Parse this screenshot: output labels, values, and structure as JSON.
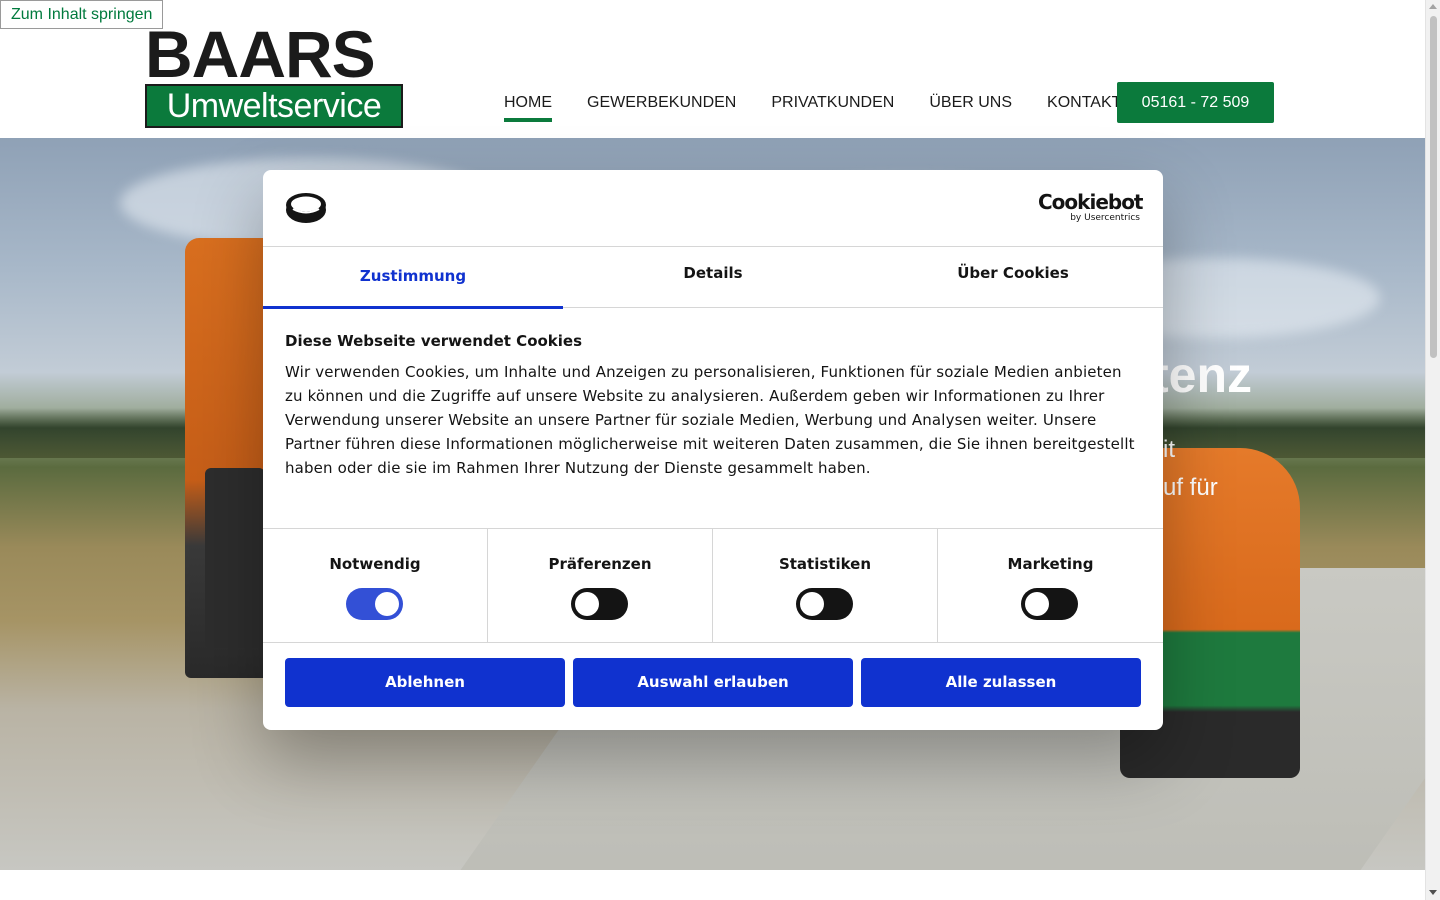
{
  "skip_link": "Zum Inhalt springen",
  "logo": {
    "line1": "BAARS",
    "line2": "Umweltservice"
  },
  "nav": {
    "items": [
      {
        "label": "HOME",
        "active": true
      },
      {
        "label": "GEWERBEKUNDEN",
        "active": false
      },
      {
        "label": "PRIVATKUNDEN",
        "active": false
      },
      {
        "label": "ÜBER UNS",
        "active": false
      },
      {
        "label": "KONTAKT",
        "active": false
      }
    ],
    "phone": "05161 - 72 509"
  },
  "hero": {
    "heading_fragment": "tenz",
    "text_fragment_1": "it",
    "text_fragment_2": "uf für"
  },
  "cookie_dialog": {
    "brand_name": "Cookiebot",
    "brand_sub": "by Usercentrics",
    "tabs": [
      {
        "label": "Zustimmung",
        "active": true
      },
      {
        "label": "Details",
        "active": false
      },
      {
        "label": "Über Cookies",
        "active": false
      }
    ],
    "title": "Diese Webseite verwendet Cookies",
    "text": "Wir verwenden Cookies, um Inhalte und Anzeigen zu personalisieren, Funktionen für soziale Medien anbieten zu können und die Zugriffe auf unsere Website zu analysieren. Außerdem geben wir Informationen zu Ihrer Verwendung unserer Website an unsere Partner für soziale Medien, Werbung und Analysen weiter. Unsere Partner führen diese Informationen möglicherweise mit weiteren Daten zusammen, die Sie ihnen bereitgestellt haben oder die sie im Rahmen Ihrer Nutzung der Dienste gesammelt haben.",
    "categories": [
      {
        "label": "Notwendig",
        "enabled": true
      },
      {
        "label": "Präferenzen",
        "enabled": false
      },
      {
        "label": "Statistiken",
        "enabled": false
      },
      {
        "label": "Marketing",
        "enabled": false
      }
    ],
    "buttons": {
      "decline": "Ablehnen",
      "allow_selection": "Auswahl erlauben",
      "allow_all": "Alle zulassen"
    }
  },
  "colors": {
    "brand_green": "#0b7a3c",
    "cookiebot_blue": "#1032cf"
  }
}
